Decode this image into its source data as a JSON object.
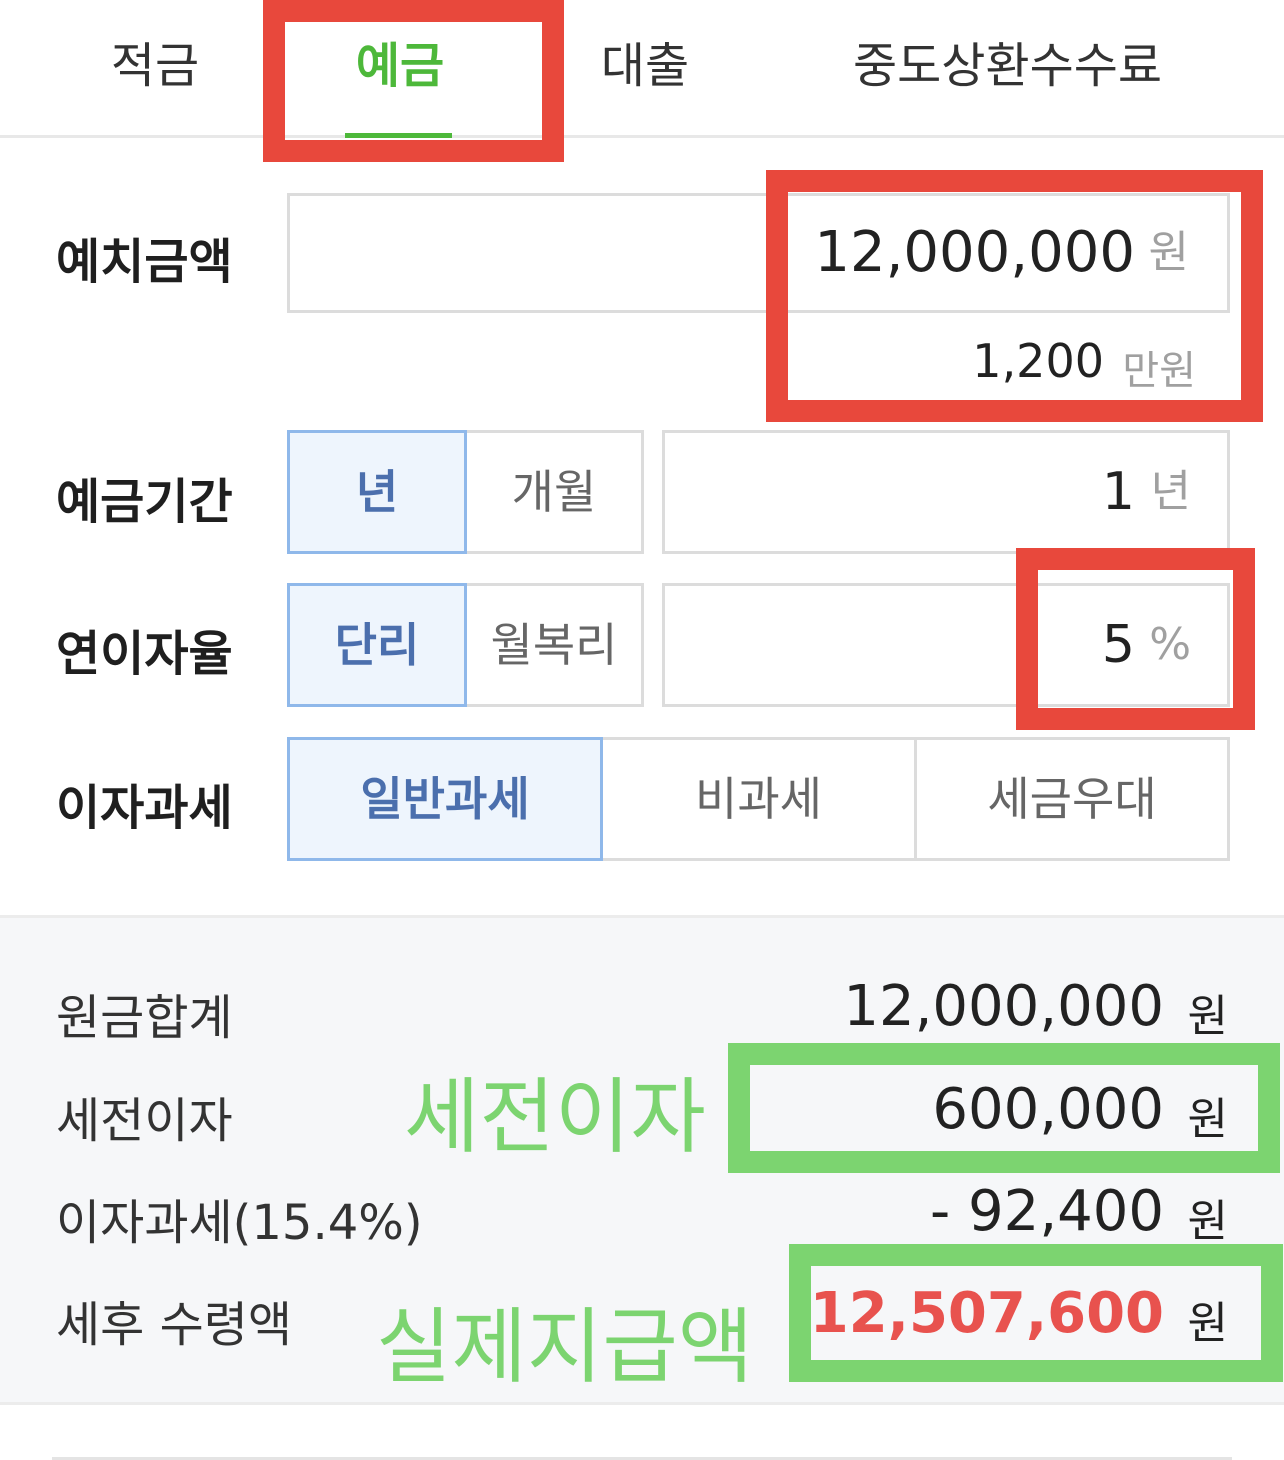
{
  "tabs": [
    {
      "label": "적금"
    },
    {
      "label": "예금"
    },
    {
      "label": "대출"
    },
    {
      "label": "중도상환수수료"
    }
  ],
  "form": {
    "deposit": {
      "label": "예치금액",
      "value": "12,000,000",
      "unit": "원",
      "sub_value": "1,200",
      "sub_unit": "만원"
    },
    "period": {
      "label": "예금기간",
      "options": [
        "년",
        "개월"
      ],
      "selected": "년",
      "value": "1",
      "unit": "년"
    },
    "rate": {
      "label": "연이자율",
      "options": [
        "단리",
        "월복리"
      ],
      "selected": "단리",
      "value": "5",
      "unit": "%"
    },
    "tax": {
      "label": "이자과세",
      "options": [
        "일반과세",
        "비과세",
        "세금우대"
      ],
      "selected": "일반과세"
    }
  },
  "result": {
    "principal": {
      "label": "원금합계",
      "value": "12,000,000",
      "unit": "원"
    },
    "pretax_interest": {
      "label": "세전이자",
      "value": "600,000",
      "unit": "원"
    },
    "interest_tax": {
      "label": "이자과세(15.4%)",
      "value": "- 92,400",
      "unit": "원"
    },
    "net": {
      "label": "세후 수령액",
      "value": "12,507,600",
      "unit": "원"
    }
  },
  "annotations": {
    "pretax_note": "세전이자",
    "net_note": "실제지급액"
  },
  "colors": {
    "accent_green": "#4db83a",
    "selected_blue": "#4b6fad",
    "result_red": "#e8524e",
    "annotation_red": "#e8483c",
    "annotation_green": "#7cd470"
  }
}
